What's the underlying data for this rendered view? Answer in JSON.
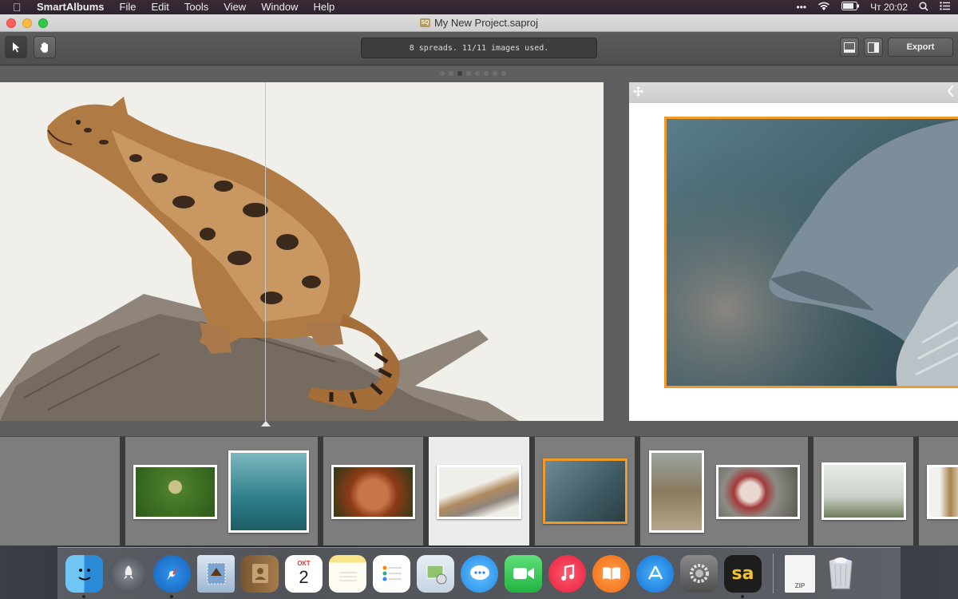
{
  "menubar": {
    "app_name": "SmartAlbums",
    "items": [
      "File",
      "Edit",
      "Tools",
      "View",
      "Window",
      "Help"
    ],
    "clock": "Чт 20:02",
    "status_dots": "•••"
  },
  "window": {
    "title": "My New Project.saproj",
    "doc_icon_text": "SQ"
  },
  "toolbar": {
    "status_text": "8 spreads. 11/11 images used.",
    "export_label": "Export"
  },
  "pager": {
    "total": 8,
    "current": 3
  },
  "colors": {
    "accent": "#f09a2a",
    "toolbar_bg": "#555555",
    "page_bg": "#f1efea"
  },
  "filmstrip": {
    "spreads": [
      {
        "images": []
      },
      {
        "images": [
          "fern",
          "turtles"
        ]
      },
      {
        "images": [
          "orangutan"
        ]
      },
      {
        "images": [
          "leopard"
        ],
        "selected": true
      },
      {
        "images": [
          "whale"
        ]
      },
      {
        "images": [
          "kangaroo",
          "fish"
        ]
      },
      {
        "images": [
          "bird-dinosaur"
        ]
      },
      {
        "images": [
          "dinosaur"
        ]
      }
    ]
  },
  "dock": {
    "calendar_month": "ОКТ",
    "calendar_day": "2",
    "smartalbums_label": "sa",
    "zip_label": "ZIP",
    "apps": [
      "finder",
      "launchpad",
      "safari",
      "mail",
      "contacts",
      "calendar",
      "notes",
      "reminders",
      "preview",
      "messages",
      "facetime",
      "itunes",
      "ibooks",
      "app-store",
      "system-preferences",
      "smartalbums",
      "zip-file",
      "trash"
    ]
  }
}
